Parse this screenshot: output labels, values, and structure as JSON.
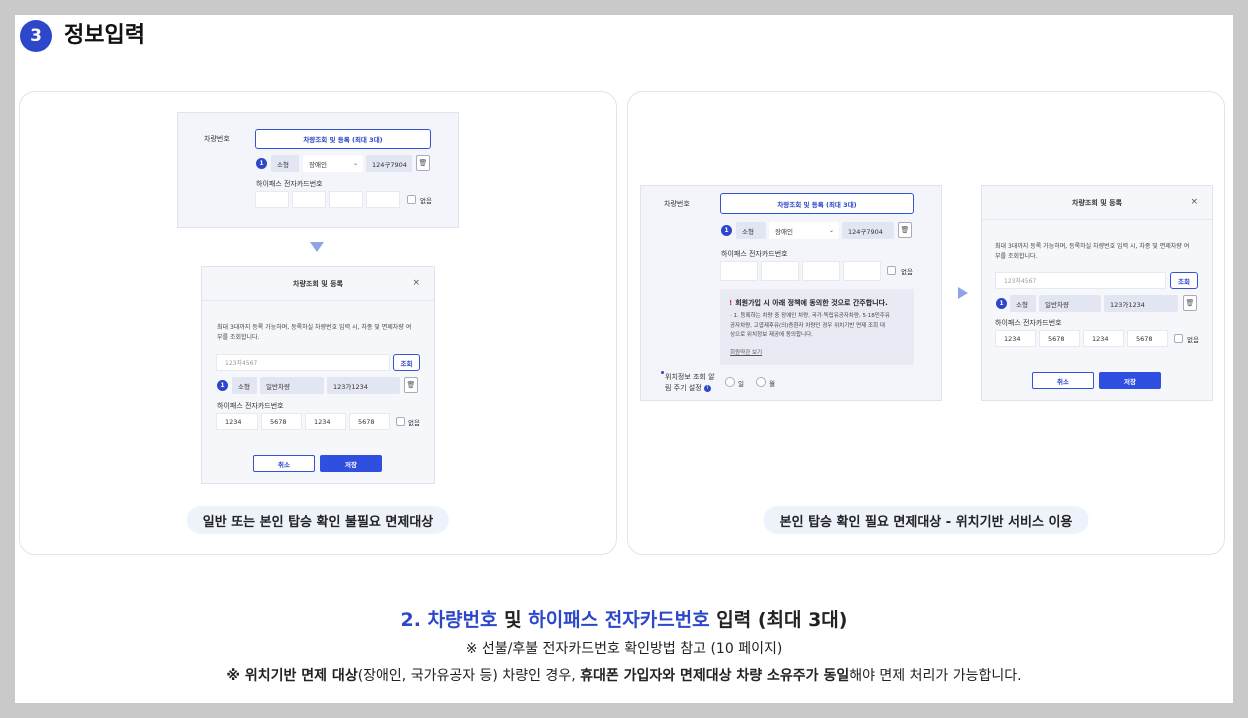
{
  "step": {
    "number": "3",
    "title": "정보입력"
  },
  "left_panel": {
    "form": {
      "vehicle_label": "차량번호",
      "lookup_button": "차량조회 및 등록 (최대 3대)",
      "row_number": "1",
      "size": "소형",
      "type": "장애인",
      "plate": "124구7904",
      "card_label": "하이패스 전자카드번호",
      "none_label": "없음"
    },
    "modal": {
      "title": "차량조회 및 등록",
      "close": "×",
      "desc_line1": "최대 3대까지 등록 가능하며, 등록하실 차량번호 입력 시, 차종 및 면제차량 여",
      "desc_line2": "부를 조회합니다.",
      "search_placeholder": "123자4567",
      "search_button": "조회",
      "row_number": "1",
      "size": "소형",
      "type": "일반차량",
      "plate": "123가1234",
      "card_label": "하이패스 전자카드번호",
      "cards": [
        "1234",
        "5678",
        "1234",
        "5678"
      ],
      "none_label": "없음",
      "cancel": "취소",
      "save": "저장"
    },
    "caption": "일반 또는 본인 탑승 확인 불필요 면제대상"
  },
  "right_panel": {
    "form": {
      "vehicle_label": "차량번호",
      "lookup_button": "차량조회 및 등록 (최대 3대)",
      "row_number": "1",
      "size": "소형",
      "type": "장애인",
      "plate": "124구7904",
      "card_label": "하이패스 전자카드번호",
      "none_label": "없음",
      "notice_title": "회원가입 시 아래 정책에 동의한 것으로 간주합니다.",
      "notice_line1": "· 1. 등록하는 차량 중 장애인 차량, 국가·독립유공자차량, 5·18민주유",
      "notice_line2": "공자차량, 고엽제후유(의)증환자 차량인 경우 위치기반 면제 조회 대",
      "notice_line3": "상으로 위치정보 제공에 동의합니다.",
      "notice_link": "회원약관 보기",
      "location_label_1": "위치정보 조회 알",
      "location_label_2": "림 주기 설정",
      "info_icon": "i",
      "radio_day": "일",
      "radio_month": "월"
    },
    "modal": {
      "title": "차량조회 및 등록",
      "close": "×",
      "desc_line1": "최대 3대까지 등록 가능하며, 등록하실 차량번호 입력 시, 차종 및 면제차량 여",
      "desc_line2": "부를 조회합니다.",
      "search_placeholder": "123자4567",
      "search_button": "조회",
      "row_number": "1",
      "size": "소형",
      "type": "일반차량",
      "plate": "123가1234",
      "card_label": "하이패스 전자카드번호",
      "cards": [
        "1234",
        "5678",
        "1234",
        "5678"
      ],
      "none_label": "없음",
      "cancel": "취소",
      "save": "저장"
    },
    "caption": "본인 탑승 확인 필요 면제대상 - 위치기반 서비스 이용"
  },
  "bottom": {
    "line1_a": "2. 차량번호",
    "line1_b": " 및 ",
    "line1_c": "하이패스 전자카드번호",
    "line1_d": " 입력 (최대 3대)",
    "line2": "※ 선불/후불 전자카드번호 확인방법 참고 (10 페이지)",
    "line3_a": "※ 위치기반 면제 대상",
    "line3_b": "(장애인, 국가유공자 등) 차량인 경우, ",
    "line3_c": "휴대폰 가입자와 면제대상 차량 소유주가 동일",
    "line3_d": "해야 면제 처리가 가능합니다."
  },
  "colors": {
    "accent": "#2c47c9",
    "save": "#2f4fe0",
    "arrow": "#8fa3e8"
  }
}
